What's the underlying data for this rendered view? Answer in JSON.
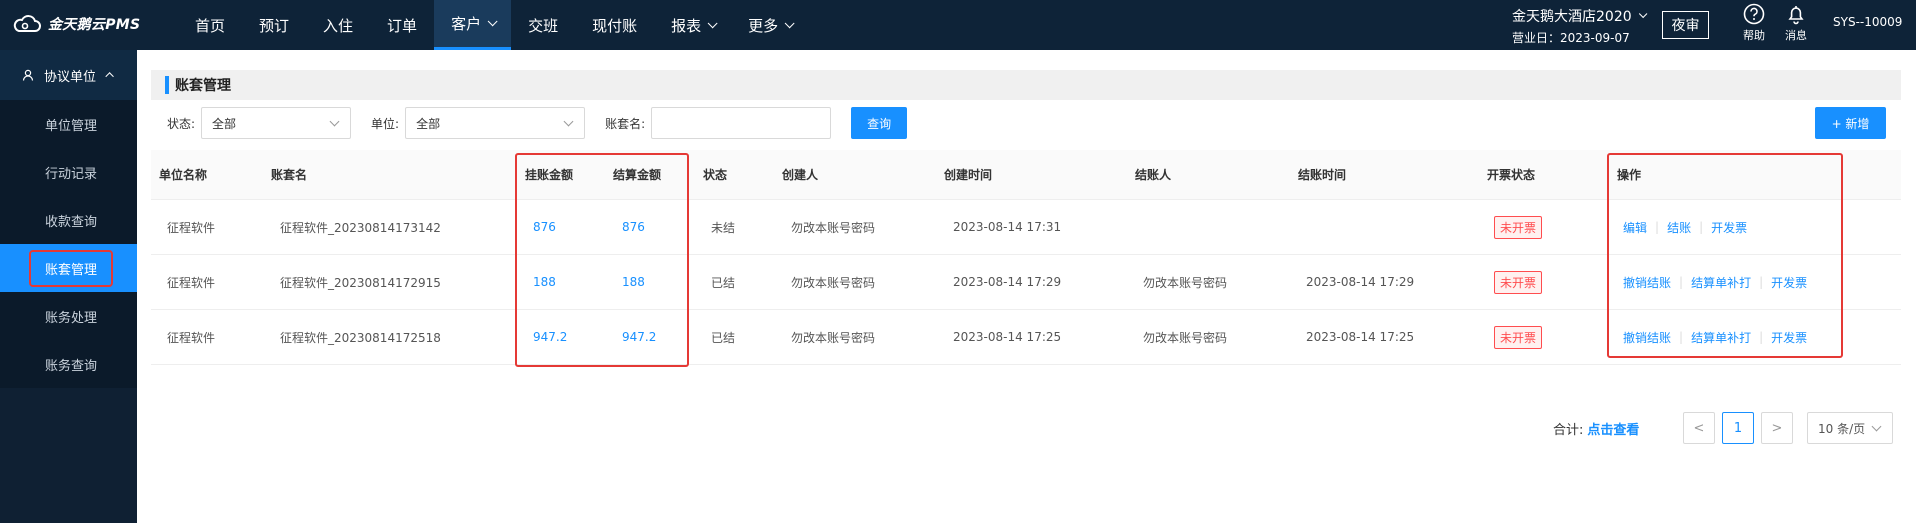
{
  "app": {
    "logo_text": "金天鹅云PMS"
  },
  "nav": [
    {
      "label": "首页",
      "dropdown": false
    },
    {
      "label": "预订",
      "dropdown": false
    },
    {
      "label": "入住",
      "dropdown": false
    },
    {
      "label": "订单",
      "dropdown": false
    },
    {
      "label": "客户",
      "dropdown": true,
      "active": true
    },
    {
      "label": "交班",
      "dropdown": false
    },
    {
      "label": "现付账",
      "dropdown": false
    },
    {
      "label": "报表",
      "dropdown": true
    },
    {
      "label": "更多",
      "dropdown": true
    }
  ],
  "header": {
    "hotel_name": "金天鹅大酒店2020",
    "business_date": "营业日：2023-09-07",
    "night_audit": "夜审",
    "help": "帮助",
    "messages": "消息",
    "user": "SYS--10009"
  },
  "sidebar": {
    "group": "协议单位",
    "items": [
      "单位管理",
      "行动记录",
      "收款查询",
      "账套管理",
      "账务处理",
      "账务查询"
    ],
    "active_index": 3
  },
  "page": {
    "title": "账套管理",
    "filters": {
      "status_label": "状态:",
      "status_value": "全部",
      "unit_label": "单位:",
      "unit_value": "全部",
      "account_label": "账套名:",
      "account_value": ""
    },
    "query_button": "查询",
    "add_button": "+ 新增"
  },
  "table": {
    "headers": [
      "单位名称",
      "账套名",
      "挂账金额",
      "结算金额",
      "状态",
      "创建人",
      "创建时间",
      "结账人",
      "结账时间",
      "开票状态",
      "操作"
    ],
    "rows": [
      {
        "unit": "征程软件",
        "account": "征程软件_20230814173142",
        "charge": "876",
        "settle": "876",
        "status": "未结",
        "creator": "勿改本账号密码",
        "created": "2023-08-14 17:31",
        "closer": "",
        "closed": "",
        "invoice": "未开票",
        "actions": [
          "编辑",
          "结账",
          "开发票"
        ]
      },
      {
        "unit": "征程软件",
        "account": "征程软件_20230814172915",
        "charge": "188",
        "settle": "188",
        "status": "已结",
        "creator": "勿改本账号密码",
        "created": "2023-08-14 17:29",
        "closer": "勿改本账号密码",
        "closed": "2023-08-14 17:29",
        "invoice": "未开票",
        "actions": [
          "撤销结账",
          "结算单补打",
          "开发票"
        ]
      },
      {
        "unit": "征程软件",
        "account": "征程软件_20230814172518",
        "charge": "947.2",
        "settle": "947.2",
        "status": "已结",
        "creator": "勿改本账号密码",
        "created": "2023-08-14 17:25",
        "closer": "勿改本账号密码",
        "closed": "2023-08-14 17:25",
        "invoice": "未开票",
        "actions": [
          "撤销结账",
          "结算单补打",
          "开发票"
        ]
      }
    ]
  },
  "footer": {
    "total_label": "合计:",
    "total_link": "点击查看",
    "prev": "<",
    "page": "1",
    "next": ">",
    "page_size": "10 条/页"
  },
  "colors": {
    "topbar": "#0e2338",
    "accent": "#1890ff",
    "highlight": "#e53935"
  }
}
